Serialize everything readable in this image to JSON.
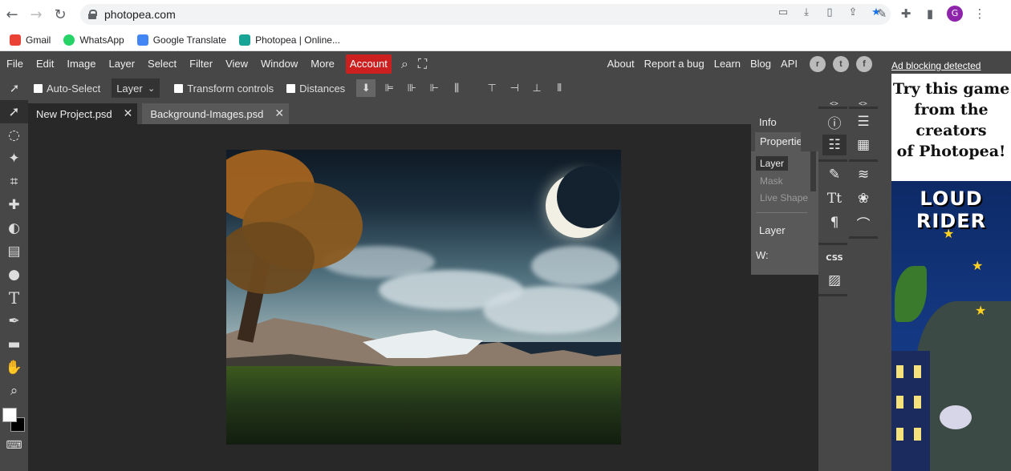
{
  "browser": {
    "url": "photopea.com",
    "bookmarks": [
      {
        "label": "Gmail",
        "color": "#ea4335"
      },
      {
        "label": "WhatsApp",
        "color": "#25d366"
      },
      {
        "label": "Google Translate",
        "color": "#4285f4"
      },
      {
        "label": "Photopea | Online...",
        "color": "#18a497"
      }
    ],
    "profile_initial": "G"
  },
  "menu": {
    "items": [
      "File",
      "Edit",
      "Image",
      "Layer",
      "Select",
      "Filter",
      "View",
      "Window",
      "More"
    ],
    "account": "Account",
    "right_links": [
      "About",
      "Report a bug",
      "Learn",
      "Blog",
      "API"
    ]
  },
  "options": {
    "auto_select": "Auto-Select",
    "layer_select": "Layer",
    "transform_controls": "Transform controls",
    "distances": "Distances"
  },
  "tabs": [
    {
      "label": "New Project.psd",
      "active": true
    },
    {
      "label": "Background-Images.psd",
      "active": false
    }
  ],
  "panel": {
    "info": "Info",
    "properties": "Properties",
    "sub_tabs": [
      "Layer",
      "Mask",
      "Live Shape"
    ],
    "layer_label": "Layer",
    "w_label": "W:"
  },
  "iconstrip": {
    "css_label": "CSS"
  },
  "ad": {
    "link": "Ad blocking detected",
    "headline_lines": [
      "Try this game",
      "from the",
      "creators",
      "of Photopea!"
    ],
    "game_title": "LOUD RIDER"
  },
  "colors": {
    "account_red": "#cc1f1f",
    "app_bg": "#474747",
    "workspace_bg": "#282828"
  }
}
